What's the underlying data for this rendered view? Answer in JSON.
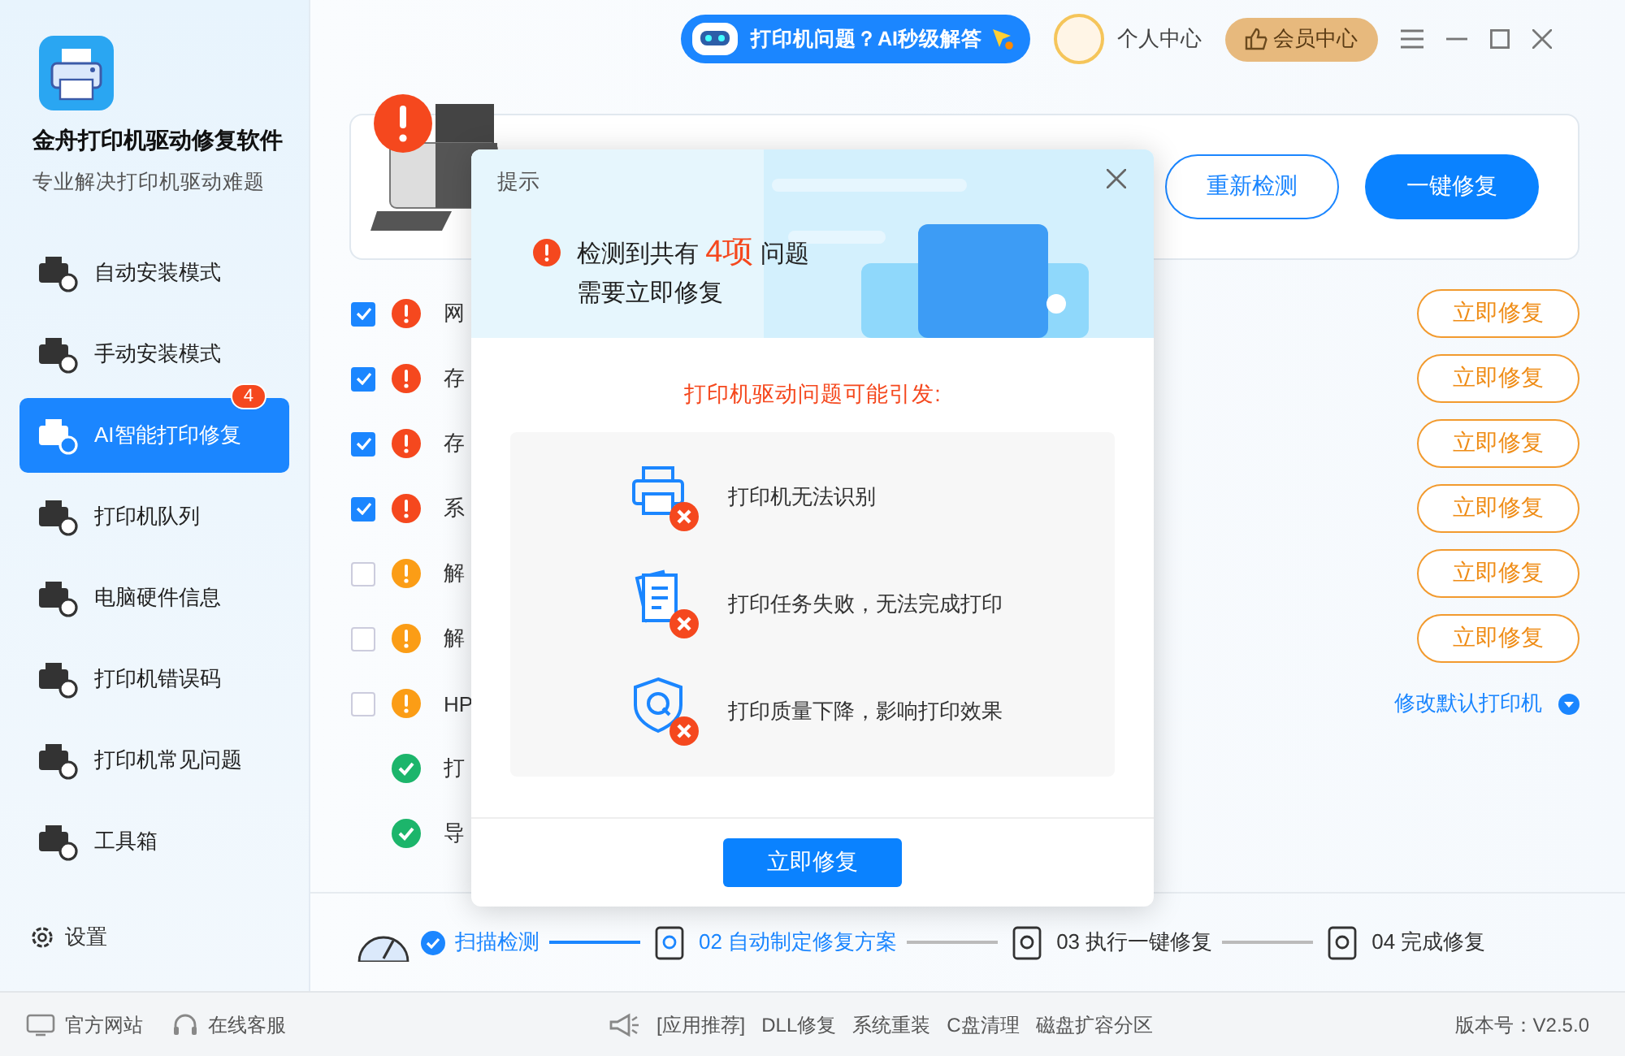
{
  "app": {
    "title": "金舟打印机驱动修复软件",
    "subtitle": "专业解决打印机驱动难题"
  },
  "topbar": {
    "ai_button": "打印机问题？AI秒级解答",
    "profile": "个人中心",
    "vip": "会员中心"
  },
  "sidebar": {
    "items": [
      {
        "label": "自动安装模式",
        "selected": false
      },
      {
        "label": "手动安装模式",
        "selected": false
      },
      {
        "label": "AI智能打印修复",
        "selected": true,
        "badge": "4"
      },
      {
        "label": "打印机队列",
        "selected": false
      },
      {
        "label": "电脑硬件信息",
        "selected": false
      },
      {
        "label": "打印机错误码",
        "selected": false
      },
      {
        "label": "打印机常见问题",
        "selected": false
      },
      {
        "label": "工具箱",
        "selected": false
      }
    ],
    "settings": "设置"
  },
  "banner": {
    "buttons": [
      {
        "label": "重新检测",
        "kind": "outline"
      },
      {
        "label": "一键修复",
        "kind": "primary"
      }
    ]
  },
  "rows": [
    {
      "kind": "issue",
      "checked": true,
      "color": "#f5481e",
      "label": "网",
      "action": {
        "kind": "button",
        "label": "立即修复"
      }
    },
    {
      "kind": "issue",
      "checked": true,
      "color": "#f5481e",
      "label": "存",
      "action": {
        "kind": "button",
        "label": "立即修复"
      }
    },
    {
      "kind": "issue",
      "checked": true,
      "color": "#f5481e",
      "label": "存",
      "action": {
        "kind": "button",
        "label": "立即修复"
      }
    },
    {
      "kind": "issue",
      "checked": true,
      "color": "#f5481e",
      "label": "系",
      "action": {
        "kind": "button",
        "label": "立即修复"
      }
    },
    {
      "kind": "issue",
      "checked": false,
      "color": "#fb9d16",
      "label": "解",
      "action": {
        "kind": "button",
        "label": "立即修复"
      }
    },
    {
      "kind": "issue",
      "checked": false,
      "color": "#fb9d16",
      "label": "解",
      "action": {
        "kind": "button",
        "label": "立即修复"
      }
    },
    {
      "kind": "issue",
      "checked": false,
      "color": "#fb9d16",
      "label": "HP",
      "action": {
        "kind": "link",
        "label": "修改默认打印机"
      }
    },
    {
      "kind": "ok",
      "label": "打"
    },
    {
      "kind": "ok",
      "label": "导"
    }
  ],
  "steps": [
    {
      "label": "扫描检测",
      "done": true,
      "active": true
    },
    {
      "label": "02 自动制定修复方案",
      "done": false,
      "active": true
    },
    {
      "label": "03 执行一键修复",
      "done": false,
      "active": false
    },
    {
      "label": "04 完成修复",
      "done": false,
      "active": false
    }
  ],
  "footer": {
    "links": [
      "官方网站",
      "在线客服"
    ],
    "promo": [
      "[应用推荐]",
      "DLL修复",
      "系统重装",
      "C盘清理",
      "磁盘扩容分区"
    ],
    "version": "版本号：V2.5.0"
  },
  "dialog": {
    "title": "提示",
    "message": "检测到共有 **4项** 问题",
    "message_2": "需要立即修复",
    "heading": "打印机驱动问题可能引发:",
    "effects": [
      {
        "kind": "printer",
        "text": "打印机无法识别"
      },
      {
        "kind": "document",
        "text": "打印任务失败，无法完成打印"
      },
      {
        "kind": "quality",
        "text": "打印质量下降，影响打印效果"
      }
    ],
    "button": "立即修复"
  }
}
